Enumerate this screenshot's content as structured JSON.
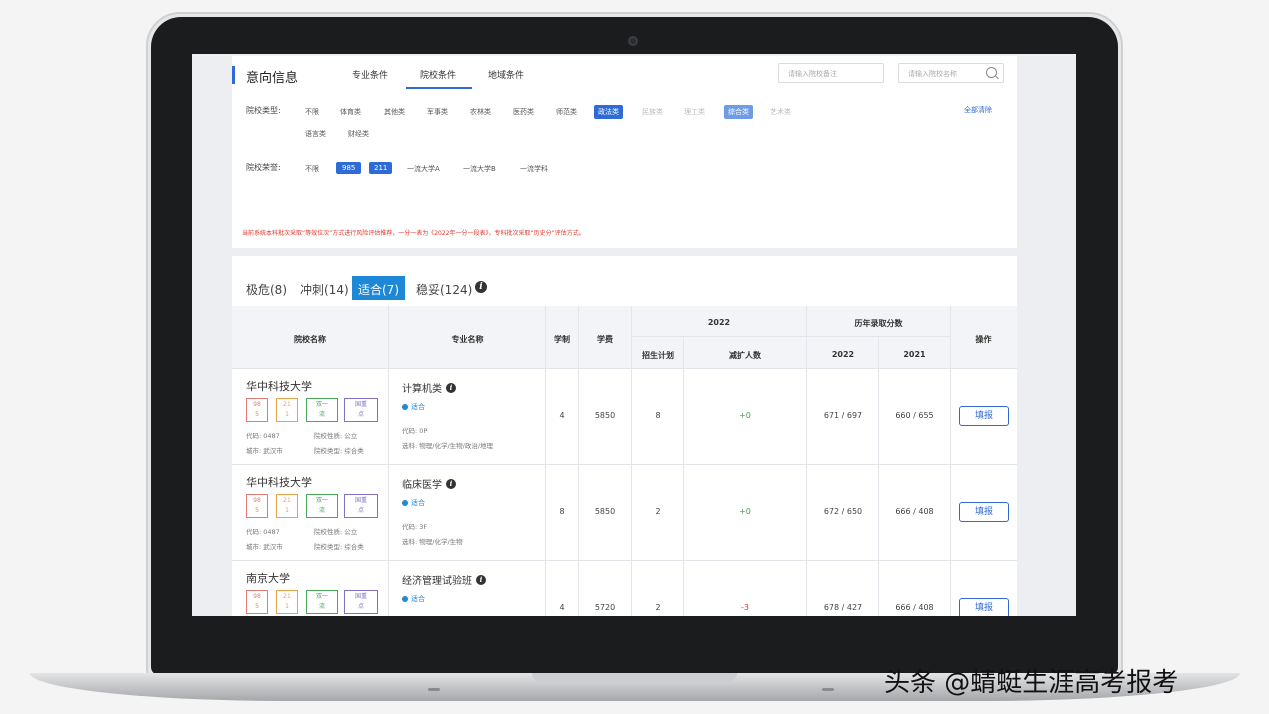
{
  "header": {
    "title": "意向信息",
    "tabs": [
      {
        "label": "专业条件"
      },
      {
        "label": "院校条件"
      },
      {
        "label": "地域条件"
      }
    ],
    "note_input_placeholder": "请输入院校备注",
    "search_input_placeholder": "请输入院校名称"
  },
  "filters": {
    "type_label": "院校类型:",
    "type_options": [
      "不限",
      "体育类",
      "其他类",
      "军事类",
      "农林类",
      "医药类",
      "师范类",
      "政法类",
      "民族类",
      "理工类",
      "综合类",
      "艺术类",
      "语言类",
      "财经类"
    ],
    "honor_label": "院校荣誉:",
    "honor_options": [
      "不限",
      "985",
      "211",
      "一流大学A",
      "一流大学B",
      "一流学科"
    ],
    "clear_label": "全部清除",
    "note": "当前系统本科批次采取“等效位次”方式进行风险评估推荐，一分一表为《2022年一分一段表》，专科批次采取“历史分”评估方式。"
  },
  "risk_tabs": [
    "极危(8)",
    "冲刺(14)",
    "适合(7)",
    "稳妥(124)"
  ],
  "table": {
    "headers": {
      "school": "院校名称",
      "major": "专业名称",
      "duration": "学制",
      "tuition": "学费",
      "year_group": "2022",
      "plan": "招生计划",
      "change": "减扩人数",
      "history_group": "历年录取分数",
      "y2022": "2022",
      "y2021": "2021",
      "action": "操作"
    },
    "rows": [
      {
        "school": "华中科技大学",
        "badges": [
          "98\n5",
          "21\n1",
          "双一\n流",
          "国重\n点"
        ],
        "code": "代码: 0487",
        "nature": "院校性质: 公立",
        "city": "城市: 武汉市",
        "kind": "院校类型: 综合类",
        "major": "计算机类",
        "fit": "适合",
        "major_code": "代码: 0P",
        "subjects": "选科: 物理/化学/生物/政治/地理",
        "duration": "4",
        "tuition": "5850",
        "plan": "8",
        "change": "+0",
        "s2022": "671 / 697",
        "s2021": "660 / 655",
        "action": "填报"
      },
      {
        "school": "华中科技大学",
        "badges": [
          "98\n5",
          "21\n1",
          "双一\n流",
          "国重\n点"
        ],
        "code": "代码: 0487",
        "nature": "院校性质: 公立",
        "city": "城市: 武汉市",
        "kind": "院校类型: 综合类",
        "major": "临床医学",
        "fit": "适合",
        "major_code": "代码: 3F",
        "subjects": "选科: 物理/化学/生物",
        "duration": "8",
        "tuition": "5850",
        "plan": "2",
        "change": "+0",
        "s2022": "672 / 650",
        "s2021": "666 / 408",
        "action": "填报"
      },
      {
        "school": "南京大学",
        "badges": [
          "98\n5",
          "21\n1",
          "双一\n流",
          "国重\n点"
        ],
        "code": "",
        "nature": "",
        "city": "",
        "kind": "",
        "major": "经济管理试验班",
        "fit": "适合",
        "major_code": "",
        "subjects": "",
        "duration": "4",
        "tuition": "5720",
        "plan": "2",
        "change": "-3",
        "s2022": "678 / 427",
        "s2021": "666 / 408",
        "action": "填报"
      }
    ]
  },
  "watermark": "头条 @蜻蜓生涯高考报考"
}
